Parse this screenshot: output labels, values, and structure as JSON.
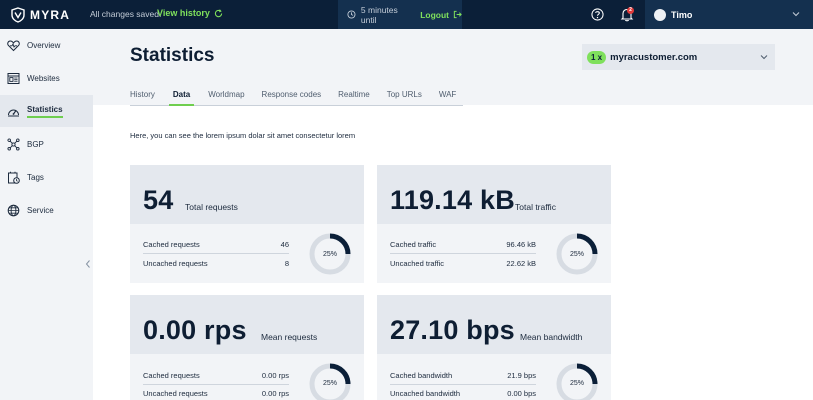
{
  "app": {
    "brand": "MYRA"
  },
  "topbar": {
    "saved_text": "All changes saved.",
    "view_history": "View history",
    "session_text": "5 minutes until",
    "logout": "Logout",
    "notifications_count": "2",
    "user_name": "Timo"
  },
  "sidebar": {
    "items": [
      {
        "label": "Overview",
        "icon": "heart-pulse-icon"
      },
      {
        "label": "Websites",
        "icon": "websites-icon"
      },
      {
        "label": "Statistics",
        "icon": "speedometer-icon"
      },
      {
        "label": "BGP",
        "icon": "network-icon"
      },
      {
        "label": "Tags",
        "icon": "tags-icon"
      },
      {
        "label": "Service",
        "icon": "globe-icon"
      }
    ],
    "active": "Statistics"
  },
  "page": {
    "title": "Statistics",
    "account": {
      "count": "1 x",
      "name": "myracustomer.com"
    },
    "tabs": [
      "History",
      "Data",
      "Worldmap",
      "Response codes",
      "Realtime",
      "Top URLs",
      "WAF"
    ],
    "active_tab": "Data",
    "intro": "Here, you can see the lorem ipsum dolar sit amet consectetur lorem"
  },
  "cards": [
    {
      "value": "54",
      "label": "Total requests",
      "rows": [
        {
          "label": "Cached requests",
          "value": "46"
        },
        {
          "label": "Uncached requests",
          "value": "8"
        }
      ],
      "percent": 25,
      "percent_label": "25%"
    },
    {
      "value": "119.14 kB",
      "label": "Total traffic",
      "rows": [
        {
          "label": "Cached traffic",
          "value": "96.46 kB"
        },
        {
          "label": "Uncached traffic",
          "value": "22.62 kB"
        }
      ],
      "percent": 25,
      "percent_label": "25%"
    },
    {
      "value": "0.00 rps",
      "label": "Mean requests",
      "rows": [
        {
          "label": "Cached requests",
          "value": "0.00 rps"
        },
        {
          "label": "Uncached requests",
          "value": "0.00 rps"
        }
      ],
      "percent": 25,
      "percent_label": "25%"
    },
    {
      "value": "27.10 bps",
      "label": "Mean bandwidth",
      "rows": [
        {
          "label": "Cached bandwidth",
          "value": "21.9 bps"
        },
        {
          "label": "Uncached bandwidth",
          "value": "0.00 bps"
        }
      ],
      "percent": 25,
      "percent_label": "25%"
    }
  ],
  "colors": {
    "navy": "#0b1f38",
    "accent": "#7fe05c",
    "panel": "#f2f4f7",
    "panel_dark": "#e4e8ee"
  }
}
